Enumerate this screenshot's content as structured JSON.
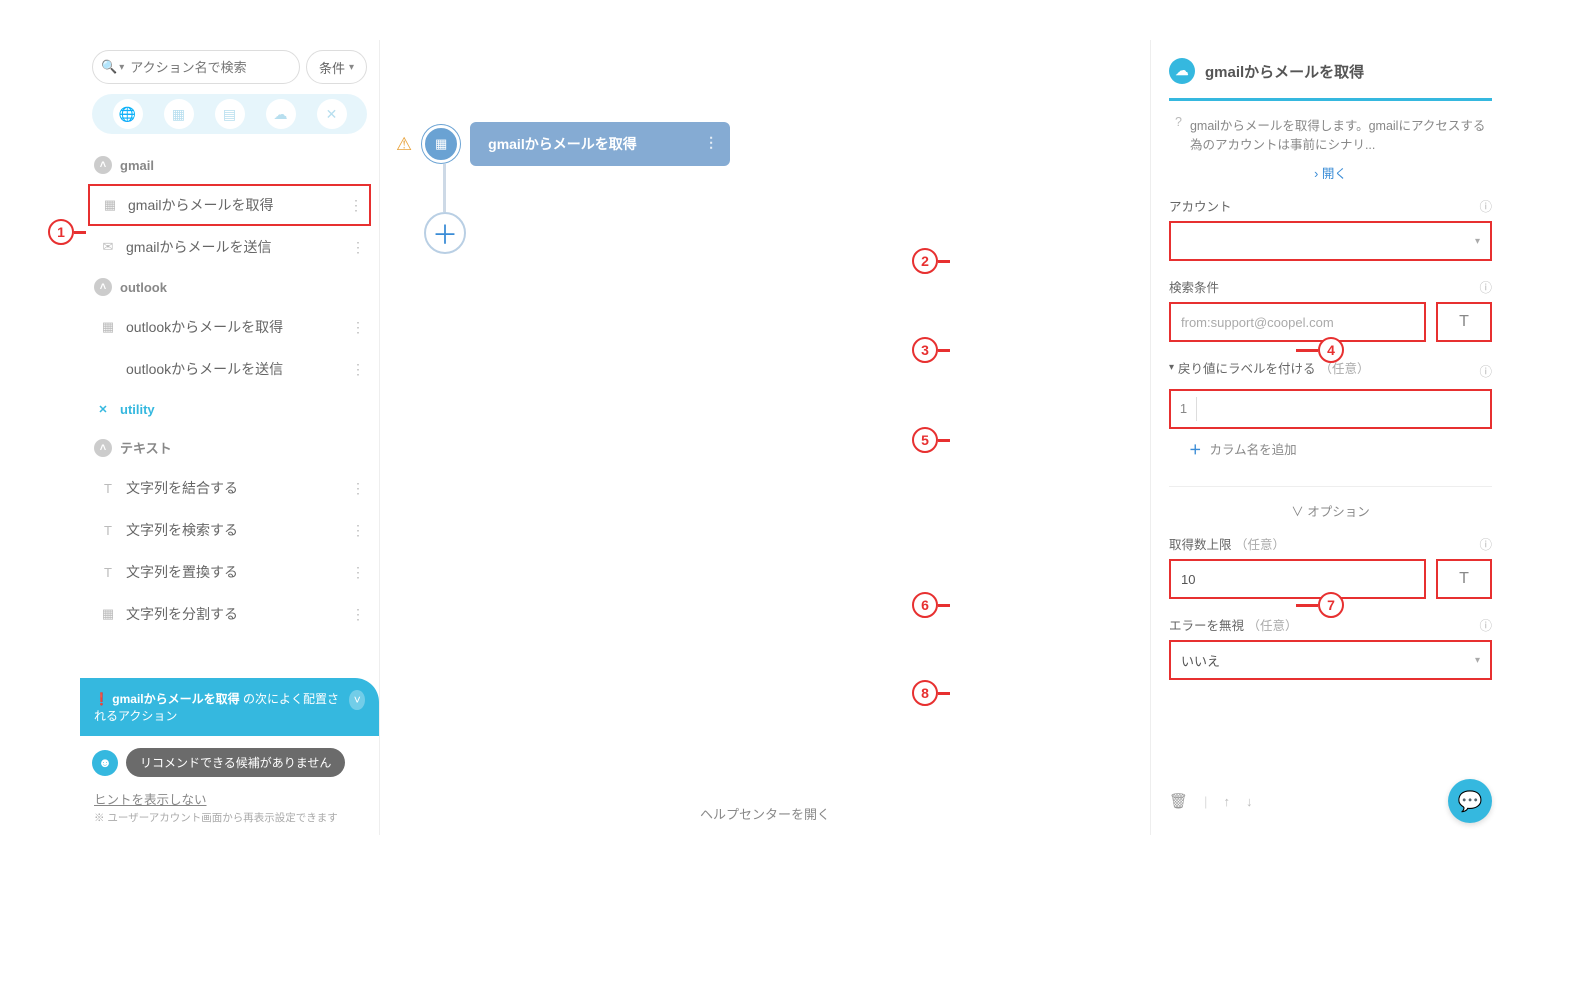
{
  "search": {
    "placeholder": "アクション名で検索",
    "condition_label": "条件"
  },
  "categories": {
    "gmail": {
      "label": "gmail",
      "items": [
        "gmailからメールを取得",
        "gmailからメールを送信"
      ]
    },
    "outlook": {
      "label": "outlook",
      "items": [
        "outlookからメールを取得",
        "outlookからメールを送信"
      ]
    },
    "utility": {
      "label": "utility"
    },
    "text": {
      "label": "テキスト",
      "items": [
        "文字列を結合する",
        "文字列を検索する",
        "文字列を置換する",
        "文字列を分割する"
      ]
    }
  },
  "recommend": {
    "title_bold": "gmailからメールを取得",
    "title_rest": " の次によく配置されるアクション",
    "chip": "リコメンドできる候補がありません"
  },
  "hint": {
    "link": "ヒントを表示しない",
    "note": "※ ユーザーアカウント画面から再表示設定できます"
  },
  "canvas": {
    "node_label": "gmailからメールを取得",
    "helpcenter": "ヘルプセンターを開く"
  },
  "panel": {
    "title": "gmailからメールを取得",
    "desc": "gmailからメールを取得します。gmailにアクセスする為のアカウントは事前にシナリ...",
    "open": "開く",
    "account_label": "アカウント",
    "search_label": "検索条件",
    "search_placeholder": "from:support@coopel.com",
    "return_label": "戻り値にラベルを付ける",
    "optional": "（任意）",
    "return_num": "1",
    "add_column": "カラム名を追加",
    "options": "オプション",
    "limit_label": "取得数上限",
    "limit_value": "10",
    "ignore_label": "エラーを無視",
    "ignore_value": "いいえ"
  },
  "callouts": [
    "1",
    "2",
    "3",
    "4",
    "5",
    "6",
    "7",
    "8"
  ]
}
